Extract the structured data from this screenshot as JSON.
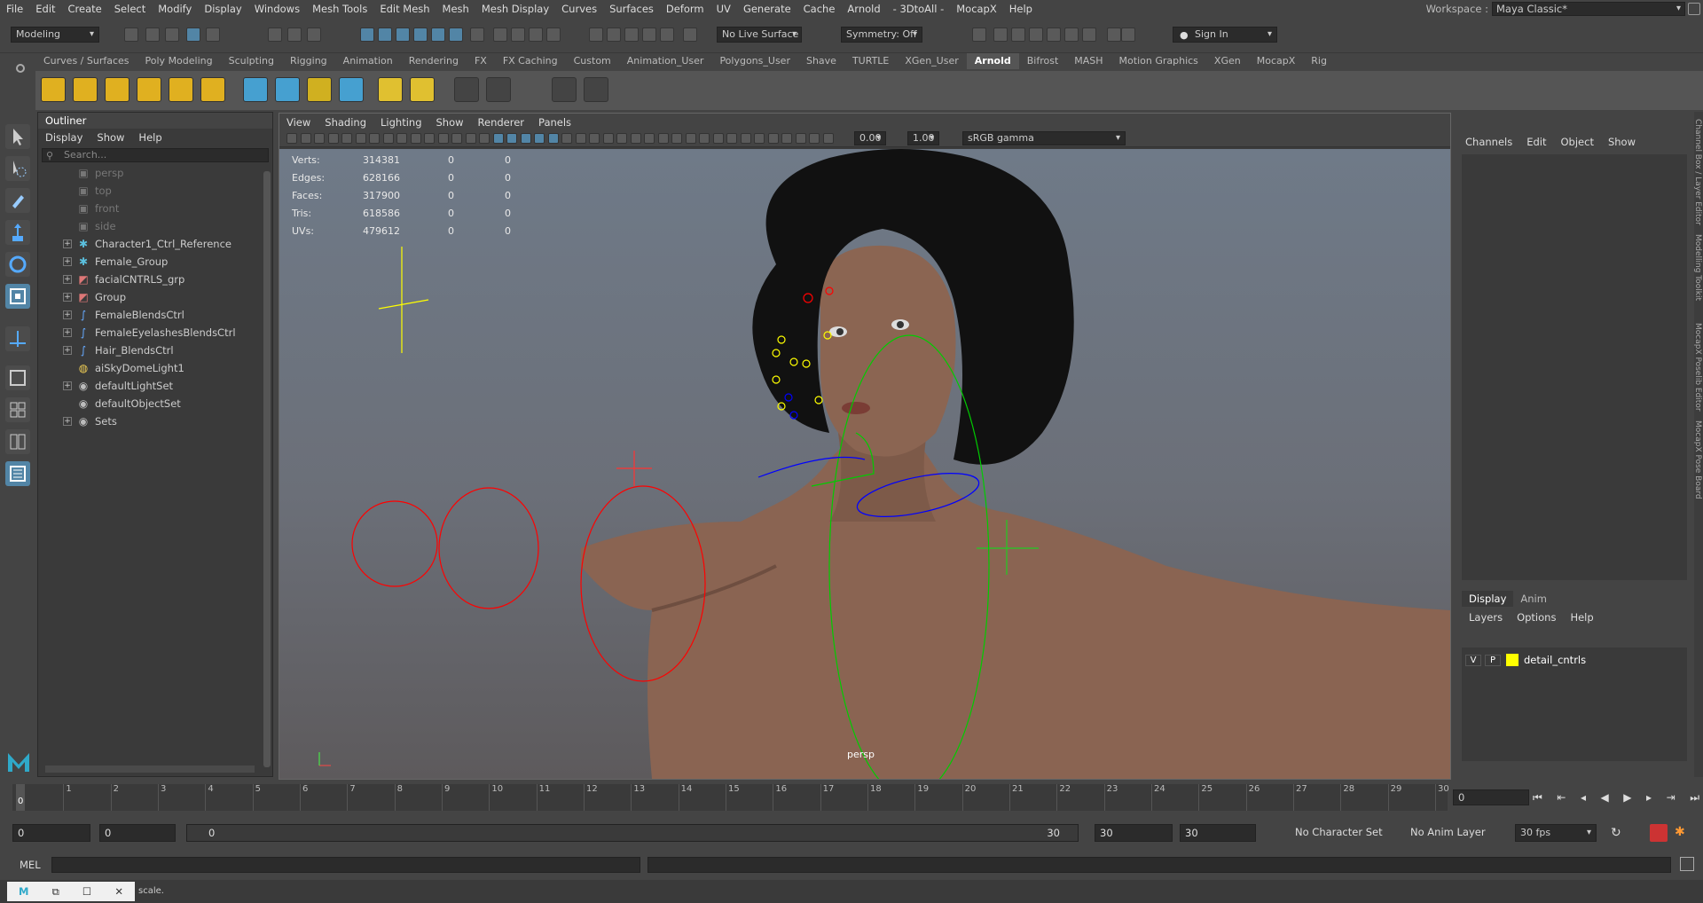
{
  "menubar": {
    "items": [
      "File",
      "Edit",
      "Create",
      "Select",
      "Modify",
      "Display",
      "Windows",
      "Mesh Tools",
      "Edit Mesh",
      "Mesh",
      "Mesh Display",
      "Curves",
      "Surfaces",
      "Deform",
      "UV",
      "Generate",
      "Cache",
      "Arnold",
      "- 3DtoAll -",
      "MocapX",
      "Help"
    ],
    "workspace_label": "Workspace :",
    "workspace_value": "Maya Classic*"
  },
  "statusline": {
    "mode": "Modeling",
    "live_surface": "No Live Surface",
    "symmetry": "Symmetry: Off",
    "sign_in": "Sign In"
  },
  "shelf": {
    "tabs": [
      "Curves / Surfaces",
      "Poly Modeling",
      "Sculpting",
      "Rigging",
      "Animation",
      "Rendering",
      "FX",
      "FX Caching",
      "Custom",
      "Animation_User",
      "Polygons_User",
      "Shave",
      "TURTLE",
      "XGen_User",
      "Arnold",
      "Bifrost",
      "MASH",
      "Motion Graphics",
      "XGen",
      "MocapX",
      "Rig"
    ],
    "active": "Arnold"
  },
  "outliner": {
    "title": "Outliner",
    "menu": [
      "Display",
      "Show",
      "Help"
    ],
    "search_placeholder": "Search...",
    "items": [
      {
        "label": "persp",
        "icon": "camera-icon",
        "expand": false,
        "dim": true
      },
      {
        "label": "top",
        "icon": "camera-icon",
        "expand": false,
        "dim": true
      },
      {
        "label": "front",
        "icon": "camera-icon",
        "expand": false,
        "dim": true
      },
      {
        "label": "side",
        "icon": "camera-icon",
        "expand": false,
        "dim": true
      },
      {
        "label": "Character1_Ctrl_Reference",
        "icon": "hik-icon",
        "expand": true,
        "dim": false
      },
      {
        "label": "Female_Group",
        "icon": "hik-icon",
        "expand": true,
        "dim": false
      },
      {
        "label": "facialCNTRLS_grp",
        "icon": "group-icon",
        "expand": true,
        "dim": false
      },
      {
        "label": "Group",
        "icon": "group-icon",
        "expand": true,
        "dim": false
      },
      {
        "label": "FemaleBlendsCtrl",
        "icon": "curve-icon",
        "expand": true,
        "dim": false
      },
      {
        "label": "FemaleEyelashesBlendsCtrl",
        "icon": "curve-icon",
        "expand": true,
        "dim": false
      },
      {
        "label": "Hair_BlendsCtrl",
        "icon": "curve-icon",
        "expand": true,
        "dim": false
      },
      {
        "label": "aiSkyDomeLight1",
        "icon": "skydome-icon",
        "expand": false,
        "dim": false
      },
      {
        "label": "defaultLightSet",
        "icon": "set-icon",
        "expand": true,
        "dim": false
      },
      {
        "label": "defaultObjectSet",
        "icon": "set-icon",
        "expand": false,
        "dim": false
      },
      {
        "label": "Sets",
        "icon": "set-icon",
        "expand": true,
        "dim": false
      }
    ]
  },
  "viewport": {
    "menu": [
      "View",
      "Shading",
      "Lighting",
      "Show",
      "Renderer",
      "Panels"
    ],
    "exposure": "0.00",
    "gamma": "1.00",
    "color_space": "sRGB gamma",
    "camera": "persp",
    "hud": [
      {
        "k": "Verts:",
        "a": "314381",
        "b": "0",
        "c": "0"
      },
      {
        "k": "Edges:",
        "a": "628166",
        "b": "0",
        "c": "0"
      },
      {
        "k": "Faces:",
        "a": "317900",
        "b": "0",
        "c": "0"
      },
      {
        "k": "Tris:",
        "a": "618586",
        "b": "0",
        "c": "0"
      },
      {
        "k": "UVs:",
        "a": "479612",
        "b": "0",
        "c": "0"
      }
    ]
  },
  "channelbox": {
    "menu": [
      "Channels",
      "Edit",
      "Object",
      "Show"
    ],
    "tabs": [
      "Display",
      "Anim"
    ],
    "layer_menu": [
      "Layers",
      "Options",
      "Help"
    ],
    "layer": {
      "v": "V",
      "p": "P",
      "name": "detail_cntrls",
      "color": "#ffff00"
    }
  },
  "side_tabs": [
    "Channel Box / Layer Editor",
    "Modelling Toolkit",
    "MocapX Poselib Editor",
    "MocapX Pose Board"
  ],
  "timeline": {
    "ticks": [
      "0",
      "1",
      "2",
      "3",
      "4",
      "5",
      "6",
      "7",
      "8",
      "9",
      "10",
      "11",
      "12",
      "13",
      "14",
      "15",
      "16",
      "17",
      "18",
      "19",
      "20",
      "21",
      "22",
      "23",
      "24",
      "25",
      "26",
      "27",
      "28",
      "29",
      "30"
    ],
    "current_frame": "0",
    "current_field": "0"
  },
  "range": {
    "start": "0",
    "playback_start": "0",
    "slider_start": "0",
    "slider_end": "30",
    "playback_end": "30",
    "end": "30",
    "character_set": "No Character Set",
    "anim_layer": "No Anim Layer",
    "fps": "30 fps"
  },
  "cmd": {
    "lang": "MEL"
  },
  "help": {
    "text": "scale."
  }
}
